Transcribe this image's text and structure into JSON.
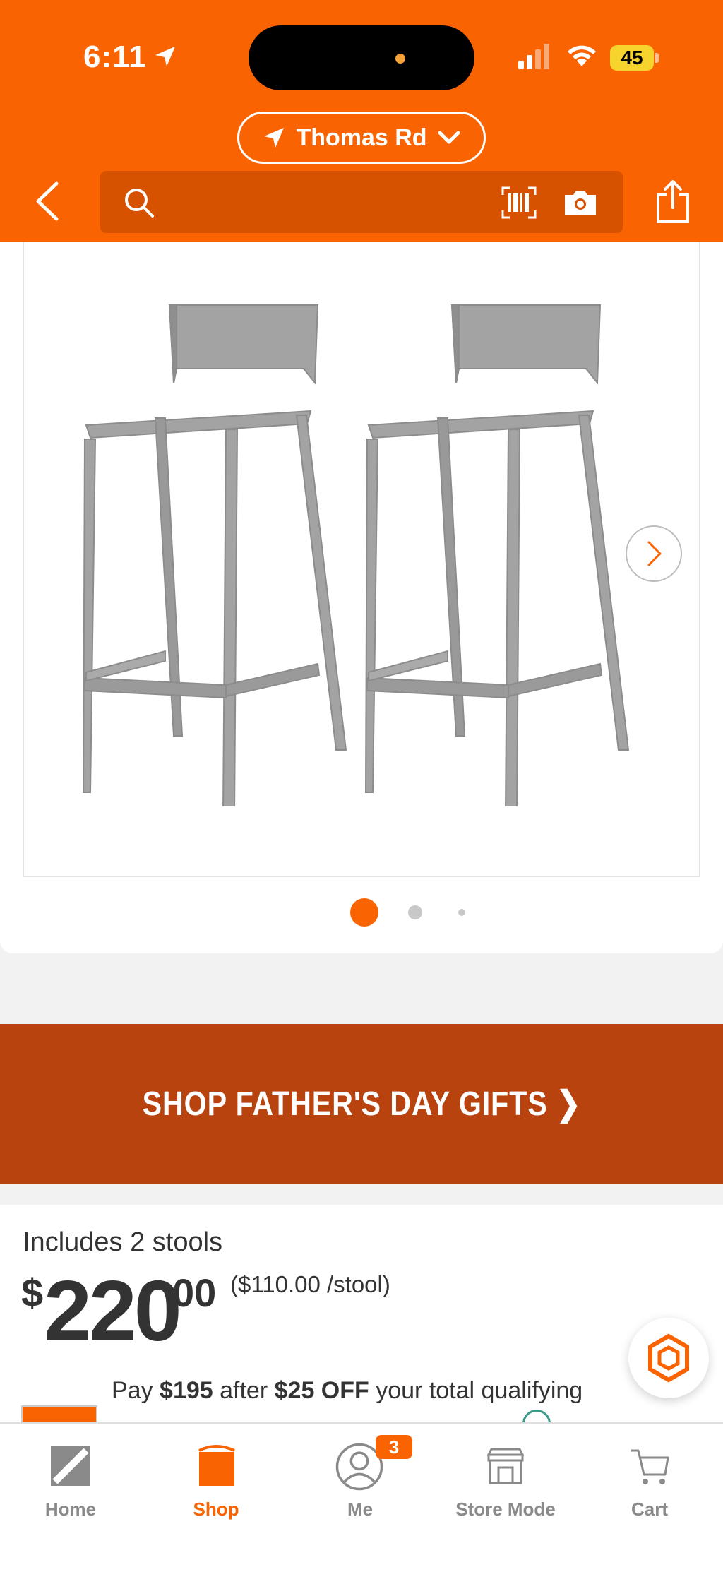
{
  "status_bar": {
    "time": "6:11",
    "battery": "45"
  },
  "header": {
    "location": "Thomas Rd",
    "search": {
      "placeholder": ""
    }
  },
  "product_image": {
    "current_slide": 1,
    "total_slides": 3
  },
  "banner": {
    "text": "SHOP FATHER'S DAY GIFTS ❯"
  },
  "pricing": {
    "includes": "Includes 2 stools",
    "currency": "$",
    "dollars": "220",
    "cents": "00",
    "per_unit": "($110.00 /stool)",
    "promo": {
      "prefix": "Pay ",
      "amount": "$195",
      "middle": " after ",
      "discount": "$25 OFF",
      "suffix": " your total qualifying"
    }
  },
  "tabbar": {
    "items": [
      {
        "label": "Home",
        "active": false
      },
      {
        "label": "Shop",
        "active": true
      },
      {
        "label": "Me",
        "active": false,
        "badge": "3"
      },
      {
        "label": "Store Mode",
        "active": false
      },
      {
        "label": "Cart",
        "active": false
      }
    ]
  },
  "colors": {
    "brand_orange": "#f96302",
    "search_bg": "#d75200",
    "banner_bg": "#b8430e",
    "inactive": "#8a8a8a"
  }
}
